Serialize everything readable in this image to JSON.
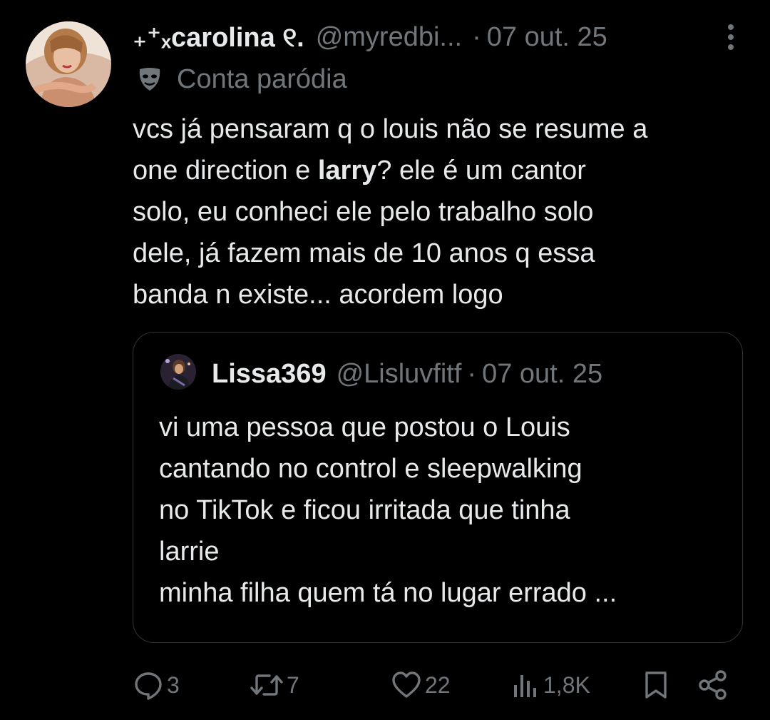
{
  "tweet": {
    "display_name": "₊⁺ₓcarolina ୧.",
    "handle": "@myredbi...",
    "separator": "·",
    "time": "07 out. 25",
    "badge_label": "Conta paródia",
    "badge_icon": "mask-icon",
    "text_lines": [
      {
        "before": "vcs já pensaram q o louis não se resume a"
      },
      {
        "before": "one direction e ",
        "bold": "larry",
        "after": "? ele é um cantor"
      },
      {
        "before": "solo, eu conheci ele pelo trabalho solo"
      },
      {
        "before": "dele, já fazem mais de 10 anos q essa"
      },
      {
        "before": "banda n existe... acordem logo"
      }
    ]
  },
  "quote": {
    "display_name": "Lissa369",
    "handle": "@Lisluvfitf",
    "separator": "·",
    "time": "07 out. 25",
    "text_lines": [
      "vi uma pessoa que postou o Louis",
      "cantando no control e sleepwalking",
      "no TikTok e ficou irritada que tinha",
      "larrie",
      "minha filha quem tá no lugar errado ..."
    ]
  },
  "actions": {
    "replies": "3",
    "reposts": "7",
    "likes": "22",
    "views": "1,8K"
  },
  "colors": {
    "background": "#000000",
    "text_primary": "#e7e9ea",
    "text_secondary": "#71767b",
    "border": "#2f3336"
  }
}
